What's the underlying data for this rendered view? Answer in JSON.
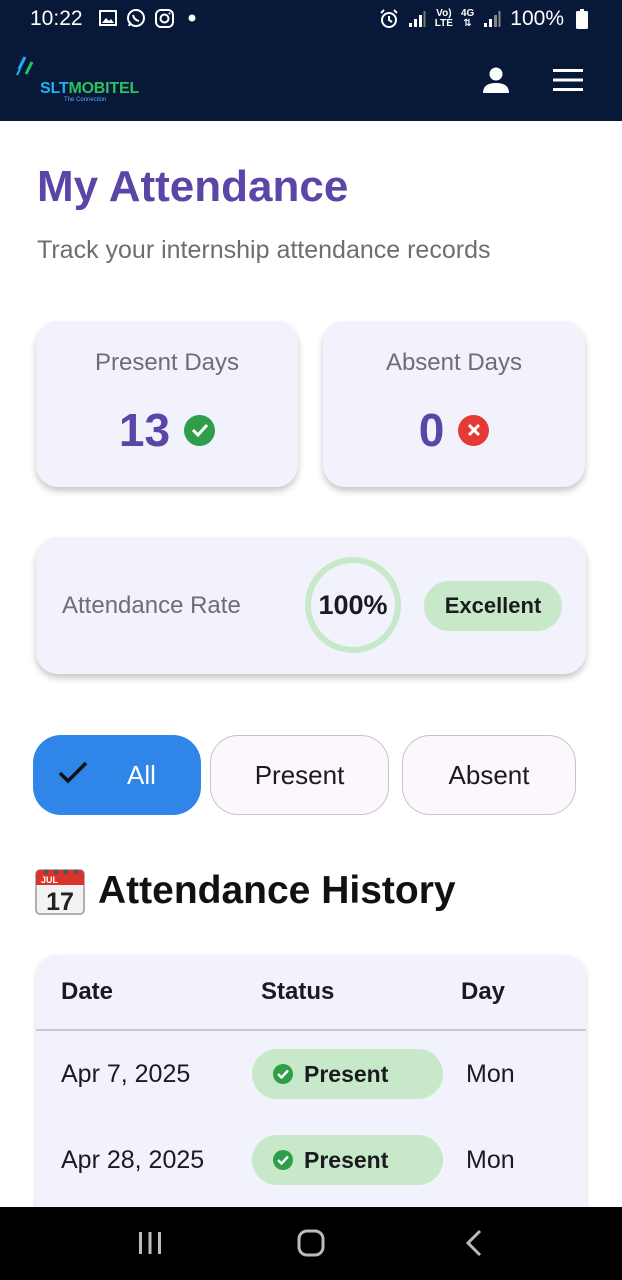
{
  "status_bar": {
    "time": "10:22",
    "battery": "100%",
    "volte_line1": "Vo)",
    "volte_line2": "LTE",
    "network": "4G"
  },
  "app_bar": {
    "brand_slt": "SLT",
    "brand_mobitel": "MOBITEL",
    "tagline": "The Connection"
  },
  "page": {
    "title": "My Attendance",
    "subtitle": "Track your internship attendance records"
  },
  "stats": {
    "present_label": "Present Days",
    "present_value": "13",
    "absent_label": "Absent Days",
    "absent_value": "0"
  },
  "rate": {
    "label": "Attendance Rate",
    "value": "100%",
    "fraction": 1.0,
    "grade": "Excellent"
  },
  "filters": {
    "all": "All",
    "present": "Present",
    "absent": "Absent"
  },
  "history": {
    "title": "Attendance History",
    "calendar_month": "JUL",
    "calendar_day": "17",
    "columns": [
      "Date",
      "Status",
      "Day"
    ],
    "rows": [
      {
        "date": "Apr 7, 2025",
        "status": "Present",
        "day": "Mon"
      },
      {
        "date": "Apr 28, 2025",
        "status": "Present",
        "day": "Mon"
      }
    ]
  },
  "colors": {
    "header_bg": "#081838",
    "title": "#5b45a7",
    "accent_blue": "#2f85e8",
    "present_green": "#2e9e48",
    "absent_red": "#e53935",
    "chip_green": "#c7e8c9"
  }
}
